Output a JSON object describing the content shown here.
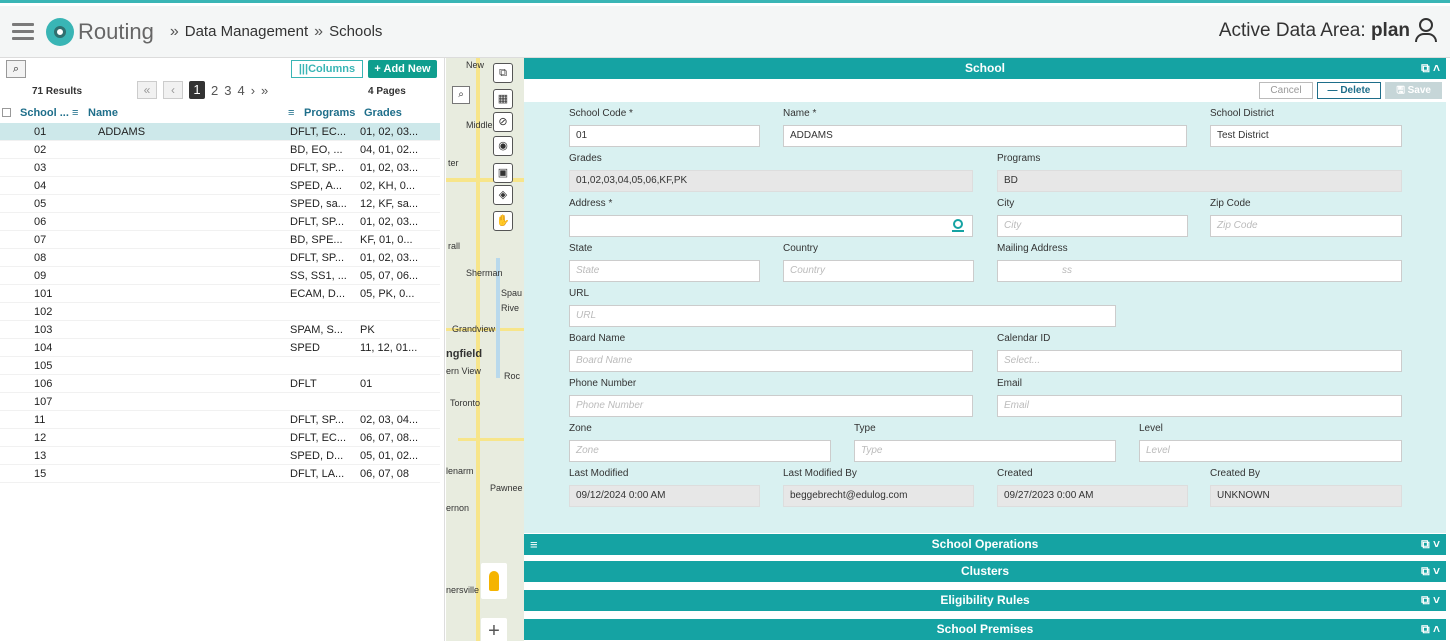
{
  "header": {
    "app_name": "Routing",
    "breadcrumb_sep": "»",
    "breadcrumbs": [
      "Data Management",
      "Schools"
    ],
    "active_area_label": "Active Data Area:",
    "active_area_value": "plan"
  },
  "list": {
    "search_icon": "⌕",
    "columns_label": "|||Columns",
    "add_new_label": "+ Add New",
    "results": "71 Results",
    "pager": {
      "first": "«",
      "prev": "‹",
      "pages": [
        "1",
        "2",
        "3",
        "4"
      ],
      "current": "1",
      "next": "›",
      "last": "»"
    },
    "pages_count": "4 Pages",
    "headers": {
      "code": "School ...",
      "name": "Name",
      "programs": "Programs",
      "grades": "Grades",
      "menu_glyph": "≡"
    },
    "rows": [
      {
        "code": "01",
        "name": "ADDAMS",
        "programs": "DFLT, EC...",
        "grades": "01, 02, 03..."
      },
      {
        "code": "02",
        "name": "",
        "programs": "BD, EO, ...",
        "grades": "04, 01, 02..."
      },
      {
        "code": "03",
        "name": "",
        "programs": "DFLT, SP...",
        "grades": "01, 02, 03..."
      },
      {
        "code": "04",
        "name": "",
        "programs": "SPED, A...",
        "grades": "02, KH, 0..."
      },
      {
        "code": "05",
        "name": "",
        "programs": "SPED, sa...",
        "grades": "12, KF, sa..."
      },
      {
        "code": "06",
        "name": "",
        "programs": "DFLT, SP...",
        "grades": "01, 02, 03..."
      },
      {
        "code": "07",
        "name": "",
        "programs": "BD, SPE...",
        "grades": "KF, 01, 0..."
      },
      {
        "code": "08",
        "name": "",
        "programs": "DFLT, SP...",
        "grades": "01, 02, 03..."
      },
      {
        "code": "09",
        "name": "",
        "programs": "SS, SS1, ...",
        "grades": "05, 07, 06..."
      },
      {
        "code": "101",
        "name": "",
        "programs": "ECAM, D...",
        "grades": "05, PK, 0..."
      },
      {
        "code": "102",
        "name": "",
        "programs": "",
        "grades": ""
      },
      {
        "code": "103",
        "name": "",
        "programs": "SPAM, S...",
        "grades": "PK"
      },
      {
        "code": "104",
        "name": "",
        "programs": "SPED",
        "grades": "11, 12, 01..."
      },
      {
        "code": "105",
        "name": "",
        "programs": "",
        "grades": ""
      },
      {
        "code": "106",
        "name": "",
        "programs": "DFLT",
        "grades": "01"
      },
      {
        "code": "107",
        "name": "",
        "programs": "",
        "grades": ""
      },
      {
        "code": "11",
        "name": "",
        "programs": "DFLT, SP...",
        "grades": "02, 03, 04..."
      },
      {
        "code": "12",
        "name": "",
        "programs": "DFLT, EC...",
        "grades": "06, 07, 08..."
      },
      {
        "code": "13",
        "name": "",
        "programs": "SPED, D...",
        "grades": "05, 01, 02..."
      },
      {
        "code": "15",
        "name": "",
        "programs": "DFLT, LA...",
        "grades": "06, 07, 08"
      }
    ]
  },
  "map": {
    "labels": [
      "New",
      "Middle",
      "ter",
      "rall",
      "Sherman",
      "Spau",
      "Rive",
      "Grandview",
      "ngfield",
      "ern View",
      "Roc",
      "Toronto",
      "lenarm",
      "Pawnee",
      "ernon",
      "nersville"
    ],
    "tools": [
      "⧉",
      "▦",
      "⊘",
      "◉",
      "▣",
      "◈",
      "✋"
    ],
    "search_icon": "⌕",
    "zoom_in": "+"
  },
  "detail": {
    "title": "School",
    "expand_icons": "⧉ ˄",
    "cancel": "Cancel",
    "delete": "— Delete",
    "save": "🖫 Save",
    "fields": {
      "school_code": {
        "label": "School Code *",
        "value": "01"
      },
      "name": {
        "label": "Name *",
        "value": "ADDAMS"
      },
      "school_district": {
        "label": "School District",
        "value": "Test District"
      },
      "grades": {
        "label": "Grades",
        "value": "01,02,03,04,05,06,KF,PK"
      },
      "programs": {
        "label": "Programs",
        "value": "BD"
      },
      "address": {
        "label": "Address *",
        "value": ""
      },
      "city": {
        "label": "City",
        "placeholder": "City"
      },
      "zip": {
        "label": "Zip Code",
        "placeholder": "Zip Code"
      },
      "state": {
        "label": "State",
        "placeholder": "State"
      },
      "country": {
        "label": "Country",
        "placeholder": "Country"
      },
      "mailing": {
        "label": "Mailing Address",
        "placeholder": "ss"
      },
      "url": {
        "label": "URL",
        "placeholder": "URL"
      },
      "board_name": {
        "label": "Board Name",
        "placeholder": "Board Name"
      },
      "calendar_id": {
        "label": "Calendar ID",
        "placeholder": "Select..."
      },
      "phone": {
        "label": "Phone Number",
        "placeholder": "Phone Number"
      },
      "email": {
        "label": "Email",
        "placeholder": "Email"
      },
      "zone": {
        "label": "Zone",
        "placeholder": "Zone"
      },
      "type": {
        "label": "Type",
        "placeholder": "Type"
      },
      "level": {
        "label": "Level",
        "placeholder": "Level"
      },
      "last_modified": {
        "label": "Last Modified",
        "value": "09/12/2024 0:00 AM"
      },
      "last_modified_by": {
        "label": "Last Modified By",
        "value": "beggebrecht@edulog.com"
      },
      "created": {
        "label": "Created",
        "value": "09/27/2023 0:00 AM"
      },
      "created_by": {
        "label": "Created By",
        "value": "UNKNOWN"
      }
    }
  },
  "sections": [
    {
      "title": "School Operations",
      "icons": "⧉ ˅"
    },
    {
      "title": "Clusters",
      "icons": "⧉ ˅"
    },
    {
      "title": "Eligibility Rules",
      "icons": "⧉ ˅"
    },
    {
      "title": "School Premises",
      "icons": "⧉ ˄"
    }
  ],
  "colors": {
    "accent": "#15a3a3",
    "form_bg": "#d9f1f1",
    "selected_row": "#cde8ea",
    "header_text": "#1e6e8a"
  }
}
